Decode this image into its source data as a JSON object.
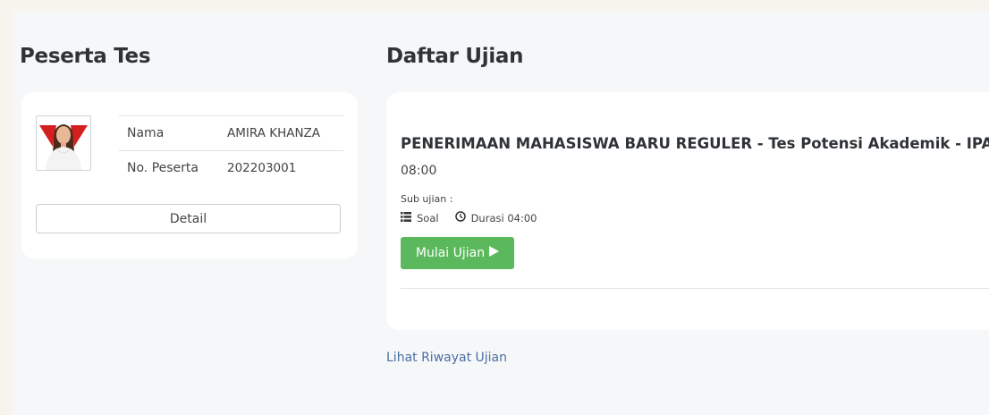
{
  "participant": {
    "section_title": "Peserta Tes",
    "name_label": "Nama",
    "name_value": "AMIRA KHANZA",
    "number_label": "No. Peserta",
    "number_value": "202203001",
    "detail_button": "Detail",
    "avatar_icon": "participant-photo"
  },
  "exams": {
    "section_title": "Daftar Ujian",
    "items": [
      {
        "title": "PENERIMAAN MAHASISWA BARU REGULER - Tes Potensi Akademik - IPA",
        "time": "08:00",
        "sub_label": "Sub ujian :",
        "soal_label": "Soal",
        "duration_label": "Durasi 04:00",
        "start_button": "Mulai Ujian",
        "list_icon": "list-icon",
        "clock_icon": "clock-icon",
        "play_icon": "play-icon"
      }
    ],
    "history_link": "Lihat Riwayat Ujian"
  },
  "colors": {
    "outer_background": "#f6f4ec",
    "page_background": "#f6f7f8",
    "card_background": "#ffffff",
    "start_button": "#5cb85c",
    "link": "#4a6fa5"
  }
}
